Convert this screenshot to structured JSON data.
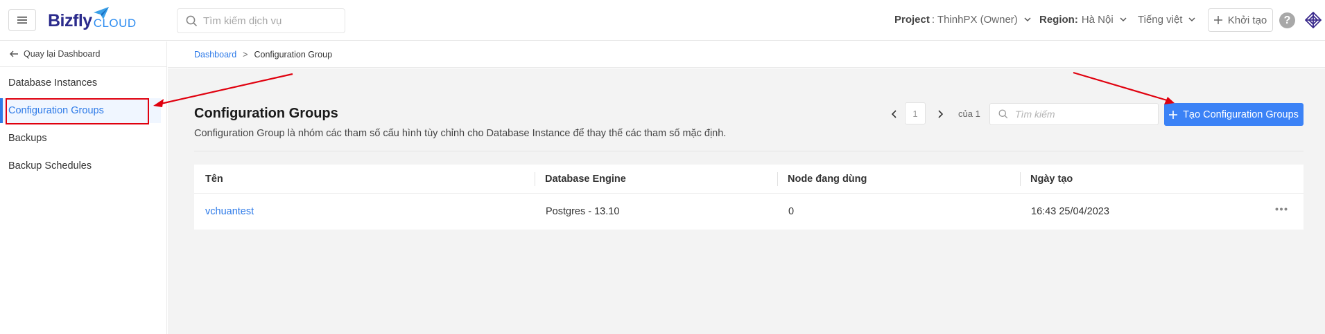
{
  "header": {
    "logo_primary": "Bizfly",
    "logo_secondary": "CLOUD",
    "search_placeholder": "Tìm kiếm dịch vụ",
    "project_label": "Project",
    "project_value": ": ThinhPX (Owner)",
    "region_label": "Region:",
    "region_value": "Hà Nội",
    "language": "Tiếng việt",
    "create_label": "Khởi tạo",
    "help_glyph": "?"
  },
  "sidebar": {
    "back_label": "Quay lại Dashboard",
    "items": [
      {
        "label": "Database Instances"
      },
      {
        "label": "Configuration Groups",
        "active": true
      },
      {
        "label": "Backups"
      },
      {
        "label": "Backup Schedules"
      }
    ]
  },
  "breadcrumb": {
    "root": "Dashboard",
    "separator": ">",
    "current": "Configuration Group"
  },
  "main": {
    "title": "Configuration Groups",
    "description": "Configuration Group là nhóm các tham số cấu hình tùy chỉnh cho Database Instance để thay thế các tham số mặc định.",
    "pagination": {
      "current_page": "1",
      "of_label": "của 1"
    },
    "search_placeholder": "Tìm kiếm",
    "create_button": "Tạo Configuration Groups",
    "table": {
      "columns": [
        "Tên",
        "Database Engine",
        "Node đang dùng",
        "Ngày tạo"
      ],
      "rows": [
        {
          "name": "vchuantest",
          "engine": "Postgres - 13.10",
          "nodes": "0",
          "created": "16:43 25/04/2023"
        }
      ]
    }
  },
  "colors": {
    "accent": "#2d7ae8",
    "primary_button": "#3b82f6",
    "annotation_red": "#e0000e",
    "brand_navy": "#2b2b8c"
  }
}
